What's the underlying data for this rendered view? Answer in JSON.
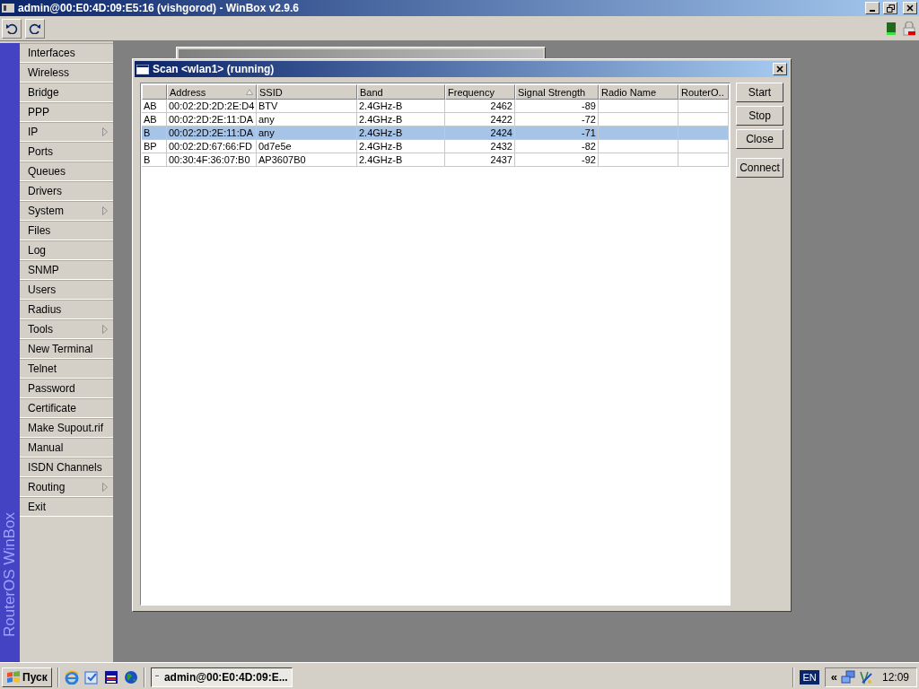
{
  "window": {
    "title": "admin@00:E0:4D:09:E5:16 (vishgorod) - WinBox v2.9.6"
  },
  "sidebar": {
    "brand": "RouterOS WinBox",
    "items": [
      {
        "label": "Interfaces",
        "submenu": false
      },
      {
        "label": "Wireless",
        "submenu": false
      },
      {
        "label": "Bridge",
        "submenu": false
      },
      {
        "label": "PPP",
        "submenu": false
      },
      {
        "label": "IP",
        "submenu": true
      },
      {
        "label": "Ports",
        "submenu": false
      },
      {
        "label": "Queues",
        "submenu": false
      },
      {
        "label": "Drivers",
        "submenu": false
      },
      {
        "label": "System",
        "submenu": true
      },
      {
        "label": "Files",
        "submenu": false
      },
      {
        "label": "Log",
        "submenu": false
      },
      {
        "label": "SNMP",
        "submenu": false
      },
      {
        "label": "Users",
        "submenu": false
      },
      {
        "label": "Radius",
        "submenu": false
      },
      {
        "label": "Tools",
        "submenu": true
      },
      {
        "label": "New Terminal",
        "submenu": false
      },
      {
        "label": "Telnet",
        "submenu": false
      },
      {
        "label": "Password",
        "submenu": false
      },
      {
        "label": "Certificate",
        "submenu": false
      },
      {
        "label": "Make Supout.rif",
        "submenu": false
      },
      {
        "label": "Manual",
        "submenu": false
      },
      {
        "label": "ISDN Channels",
        "submenu": false
      },
      {
        "label": "Routing",
        "submenu": true
      },
      {
        "label": "Exit",
        "submenu": false
      }
    ]
  },
  "scan_window": {
    "title": "Scan <wlan1> (running)",
    "columns": [
      {
        "label": "Address",
        "sorted": true
      },
      {
        "label": "SSID",
        "sorted": false
      },
      {
        "label": "Band",
        "sorted": false
      },
      {
        "label": "Frequency",
        "sorted": false
      },
      {
        "label": "Signal Strength",
        "sorted": false
      },
      {
        "label": "Radio Name",
        "sorted": false
      },
      {
        "label": "RouterO..",
        "sorted": false
      }
    ],
    "rows": [
      {
        "flags": "AB",
        "address": "00:02:2D:2D:2E:D4",
        "ssid": "BTV",
        "band": "2.4GHz-B",
        "frequency": "2462",
        "signal_strength": "-89",
        "selected": false
      },
      {
        "flags": "AB",
        "address": "00:02:2D:2E:11:DA",
        "ssid": "any",
        "band": "2.4GHz-B",
        "frequency": "2422",
        "signal_strength": "-72",
        "selected": false
      },
      {
        "flags": "B",
        "address": "00:02:2D:2E:11:DA",
        "ssid": "any",
        "band": "2.4GHz-B",
        "frequency": "2424",
        "signal_strength": "-71",
        "selected": true
      },
      {
        "flags": "BP",
        "address": "00:02:2D:67:66:FD",
        "ssid": "0d7e5e",
        "band": "2.4GHz-B",
        "frequency": "2432",
        "signal_strength": "-82",
        "selected": false
      },
      {
        "flags": "B",
        "address": "00:30:4F:36:07:B0",
        "ssid": "AP3607B0",
        "band": "2.4GHz-B",
        "frequency": "2437",
        "signal_strength": "-92",
        "selected": false
      }
    ],
    "buttons": [
      "Start",
      "Stop",
      "Close",
      "Connect"
    ]
  },
  "taskbar": {
    "start": "Пуск",
    "tasks": [
      {
        "label": "admin@00:E0:4D:09:E...",
        "selected": true
      }
    ],
    "language": "EN",
    "tray_chevron": "«",
    "clock": "12:09"
  }
}
